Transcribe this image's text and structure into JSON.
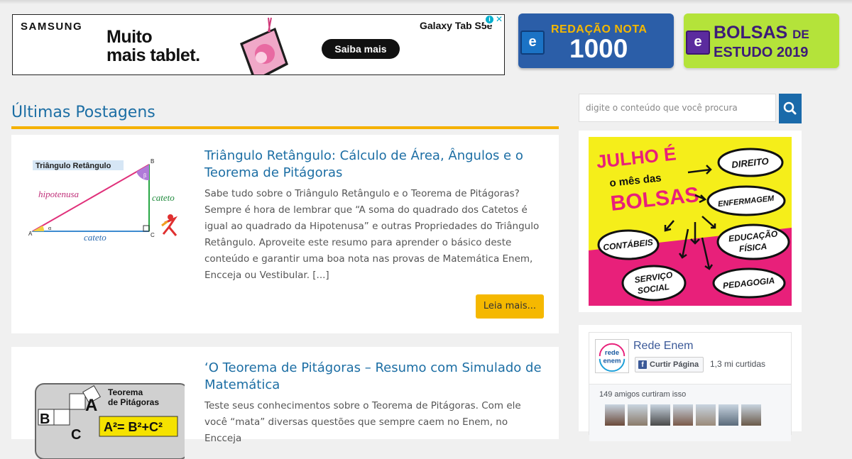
{
  "ad": {
    "brand": "SAMSUNG",
    "headline_line1": "Muito",
    "headline_line2": "mais tablet.",
    "product": "Galaxy Tab S5e",
    "cta": "Saiba mais"
  },
  "promos": [
    {
      "title": "REDAÇÃO NOTA",
      "subtitle": "1000",
      "logo": "e"
    },
    {
      "title": "BOLSAS",
      "title_suffix": "DE",
      "subtitle": "ESTUDO 2019",
      "logo": "e"
    }
  ],
  "section_title": "Últimas Postagens",
  "posts": [
    {
      "title": "Triângulo Retângulo: Cálculo de Área, Ângulos e o Teorema de Pitágoras",
      "excerpt": "Sabe tudo sobre o Triângulo Retângulo e o Teorema de Pitágoras? Sempre é hora de lembrar que “A soma do quadrado dos Catetos é igual ao quadrado da Hipotenusa” e outras Propriedades do Triângulo Retângulo. Aproveite este resumo para aprender o básico deste conteúdo e garantir uma boa nota nas provas de Matemática Enem, Encceja ou Vestibular. [...]",
      "read_more": "Leia mais...",
      "thumb": {
        "label": "Triângulo Retângulo",
        "hyp": "hipotenusa",
        "leg_v": "cateto",
        "leg_h": "cateto",
        "A": "A",
        "B": "B",
        "C": "C",
        "alpha": "α",
        "beta": "β"
      }
    },
    {
      "title": "‘O Teorema de Pitágoras – Resumo com Simulado de Matemática",
      "excerpt": "Teste seus conhecimentos sobre o Teorema de Pitágoras. Com ele você “mata” diversas questões que sempre caem no Enem, no Encceja",
      "thumb": {
        "label_line1": "Teorema",
        "label_line2": "de Pitágoras",
        "formula": "A²= B²+C²",
        "A": "A",
        "B": "B",
        "C": "C"
      }
    }
  ],
  "sidebar": {
    "search_placeholder": "digite o conteúdo que você procura",
    "bolsas_banner": {
      "line1": "JULHO É",
      "line2": "o mês das",
      "line3": "BOLSAS",
      "courses": [
        "DIREITO",
        "ENFERMAGEM",
        "CONTÁBEIS",
        "EDUCAÇÃO",
        "FÍSICA",
        "SERVIÇO",
        "SOCIAL",
        "PEDAGOGIA"
      ]
    },
    "facebook": {
      "logo_line1": "rede",
      "logo_line2": "enem",
      "page_name": "Rede Enem",
      "like_button": "Curtir Página",
      "likes": "1,3 mi curtidas",
      "friends_text": "149 amigos curtiram isso",
      "friend_count": 7
    }
  },
  "colors": {
    "link_blue": "#1c6ea4",
    "accent_yellow": "#f5b800",
    "promo_blue": "#2b5ea8",
    "promo_green": "#b4e33a",
    "bolsas_yellow": "#f5ee1a",
    "bolsas_pink": "#e8207a"
  }
}
